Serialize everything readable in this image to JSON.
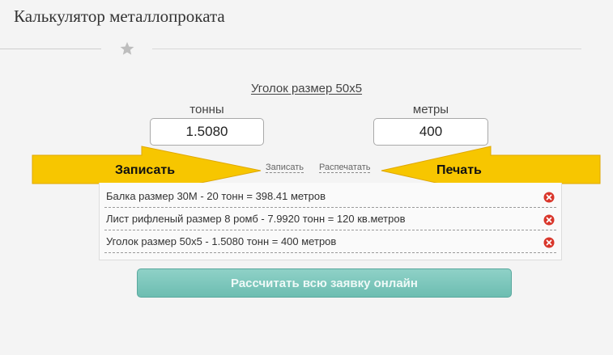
{
  "header": {
    "title": "Калькулятор металлопроката"
  },
  "calculator": {
    "product_title": "Уголок размер 50х5",
    "tons": {
      "label": "тонны",
      "value": "1.5080"
    },
    "meters": {
      "label": "метры",
      "value": "400"
    },
    "actions": {
      "save": "Записать",
      "print": "Распечатать"
    }
  },
  "annotations": {
    "left_arrow": "Записать",
    "right_arrow": "Печать",
    "arrow_color": "#f7c600"
  },
  "saved_list": {
    "items": [
      {
        "text": "Балка размер 30М - 20 тонн = 398.41 метров"
      },
      {
        "text": "Лист рифленый размер 8 ромб - 7.9920 тонн = 120 кв.метров"
      },
      {
        "text": "Уголок размер 50х5 - 1.5080 тонн = 400 метров"
      }
    ],
    "remove_icon": "remove-icon",
    "remove_color": "#d9362b"
  },
  "submit": {
    "label": "Рассчитать всю заявку онлайн",
    "color": "#79c5ba"
  }
}
